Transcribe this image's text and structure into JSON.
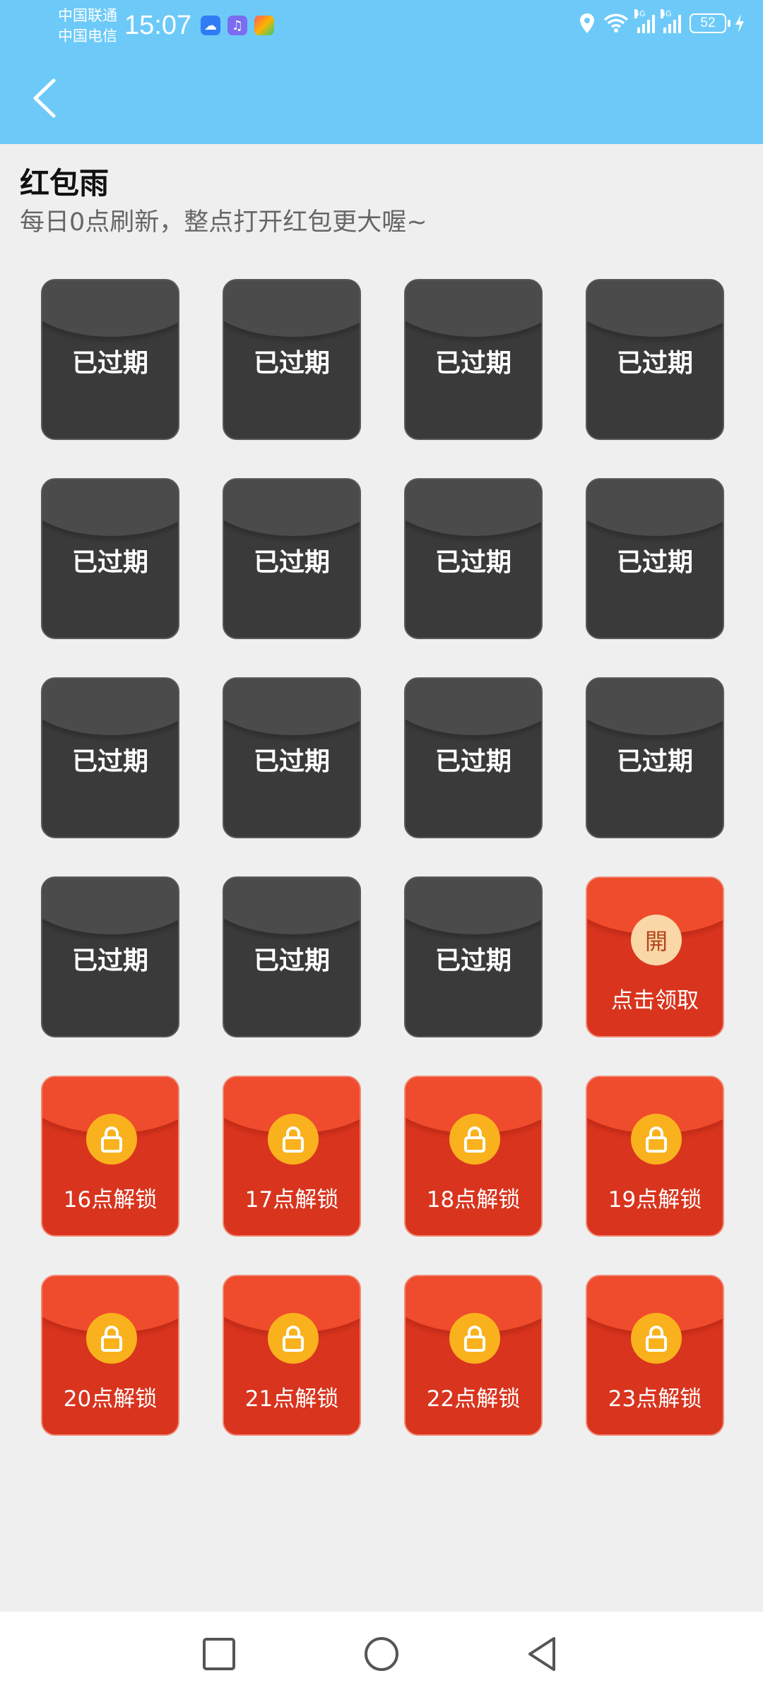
{
  "status_bar": {
    "carrier_1": "中国联通",
    "carrier_2": "中国电信",
    "time": "15:07",
    "network_1": "4G",
    "network_2": "4G",
    "battery": "52"
  },
  "page": {
    "title": "红包雨",
    "subtitle": "每日0点刷新，整点打开红包更大喔~"
  },
  "envelopes": [
    {
      "status": "expired",
      "label": "已过期"
    },
    {
      "status": "expired",
      "label": "已过期"
    },
    {
      "status": "expired",
      "label": "已过期"
    },
    {
      "status": "expired",
      "label": "已过期"
    },
    {
      "status": "expired",
      "label": "已过期"
    },
    {
      "status": "expired",
      "label": "已过期"
    },
    {
      "status": "expired",
      "label": "已过期"
    },
    {
      "status": "expired",
      "label": "已过期"
    },
    {
      "status": "expired",
      "label": "已过期"
    },
    {
      "status": "expired",
      "label": "已过期"
    },
    {
      "status": "expired",
      "label": "已过期"
    },
    {
      "status": "expired",
      "label": "已过期"
    },
    {
      "status": "expired",
      "label": "已过期"
    },
    {
      "status": "expired",
      "label": "已过期"
    },
    {
      "status": "expired",
      "label": "已过期"
    },
    {
      "status": "available",
      "label": "点击领取",
      "badge": "開"
    },
    {
      "status": "locked",
      "label": "16点解锁"
    },
    {
      "status": "locked",
      "label": "17点解锁"
    },
    {
      "status": "locked",
      "label": "18点解锁"
    },
    {
      "status": "locked",
      "label": "19点解锁"
    },
    {
      "status": "locked",
      "label": "20点解锁"
    },
    {
      "status": "locked",
      "label": "21点解锁"
    },
    {
      "status": "locked",
      "label": "22点解锁"
    },
    {
      "status": "locked",
      "label": "23点解锁"
    }
  ],
  "colors": {
    "header_bg": "#6dcaf8",
    "expired_envelope": "#3a3a3a",
    "red_envelope": "#d9341e",
    "lock_badge": "#f9b21d",
    "open_badge": "#fad7a6"
  },
  "icons": {
    "back": "chevron-left-icon",
    "lock": "lock-icon",
    "nav_recents": "square-icon",
    "nav_home": "circle-icon",
    "nav_back": "triangle-back-icon"
  }
}
